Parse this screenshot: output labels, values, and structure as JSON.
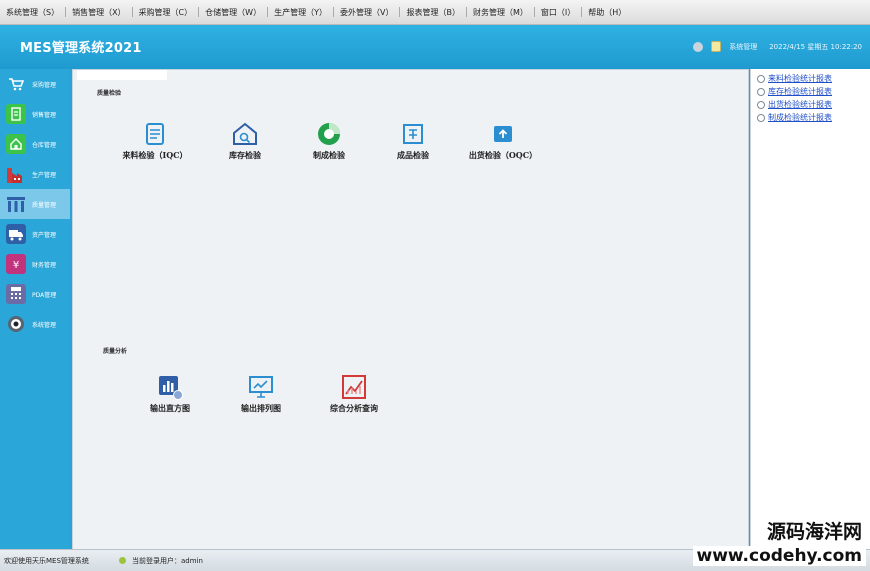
{
  "menu": [
    "系统管理（S）",
    "销售管理（X）",
    "采购管理（C）",
    "仓储管理（W）",
    "生产管理（Y）",
    "委外管理（V）",
    "报表管理（B）",
    "财务管理（M）",
    "窗口（I）",
    "帮助（H）"
  ],
  "header": {
    "title": "MES管理系统2021",
    "user": "系统管理",
    "datetime": "2022/4/15 星期五 10:22:20"
  },
  "sidebar": {
    "items": [
      {
        "label": "采购管理",
        "icon": "cart-icon",
        "color": "#2aa3d4"
      },
      {
        "label": "销售管理",
        "icon": "document-icon",
        "color": "#3cc44a"
      },
      {
        "label": "仓库管理",
        "icon": "house-icon",
        "color": "#3cc44a"
      },
      {
        "label": "生产管理",
        "icon": "factory-icon",
        "color": "#d23a3a"
      },
      {
        "label": "质量管理",
        "icon": "columns-icon",
        "color": "#2f5fa7"
      },
      {
        "label": "资产管理",
        "icon": "truck-icon",
        "color": "#2f5fa7"
      },
      {
        "label": "财务管理",
        "icon": "money-bag-icon",
        "color": "#c2337e"
      },
      {
        "label": "PDA管理",
        "icon": "calculator-icon",
        "color": "#6b6ba5"
      },
      {
        "label": "系统管理",
        "icon": "eye-gear-icon",
        "color": "#5a6470"
      }
    ],
    "active_index": 4
  },
  "main": {
    "section_inspection": "质量检验",
    "section_analysis": "质量分析",
    "inspection_tiles": [
      {
        "label": "来料检验（IQC）",
        "icon": "checklist-icon"
      },
      {
        "label": "库存检验",
        "icon": "warehouse-search-icon"
      },
      {
        "label": "制成检验",
        "icon": "pie-progress-icon"
      },
      {
        "label": "成品检验",
        "icon": "box-check-icon"
      },
      {
        "label": "出货检验（OQC）",
        "icon": "shipping-box-icon"
      }
    ],
    "analysis_tiles": [
      {
        "label": "输出直方图",
        "icon": "bar-chart-icon"
      },
      {
        "label": "输出排列图",
        "icon": "presentation-chart-icon"
      },
      {
        "label": "综合分析查询",
        "icon": "trend-analysis-icon"
      }
    ]
  },
  "reports": [
    "来料检验统计报表",
    "库存检验统计报表",
    "出货检验统计报表",
    "制成检验统计报表"
  ],
  "status": {
    "welcome": "欢迎使用天乐MES管理系统",
    "user": "当前登录用户：admin"
  },
  "watermark": {
    "line1": "源码海洋网",
    "line2": "www.codehy.com"
  }
}
